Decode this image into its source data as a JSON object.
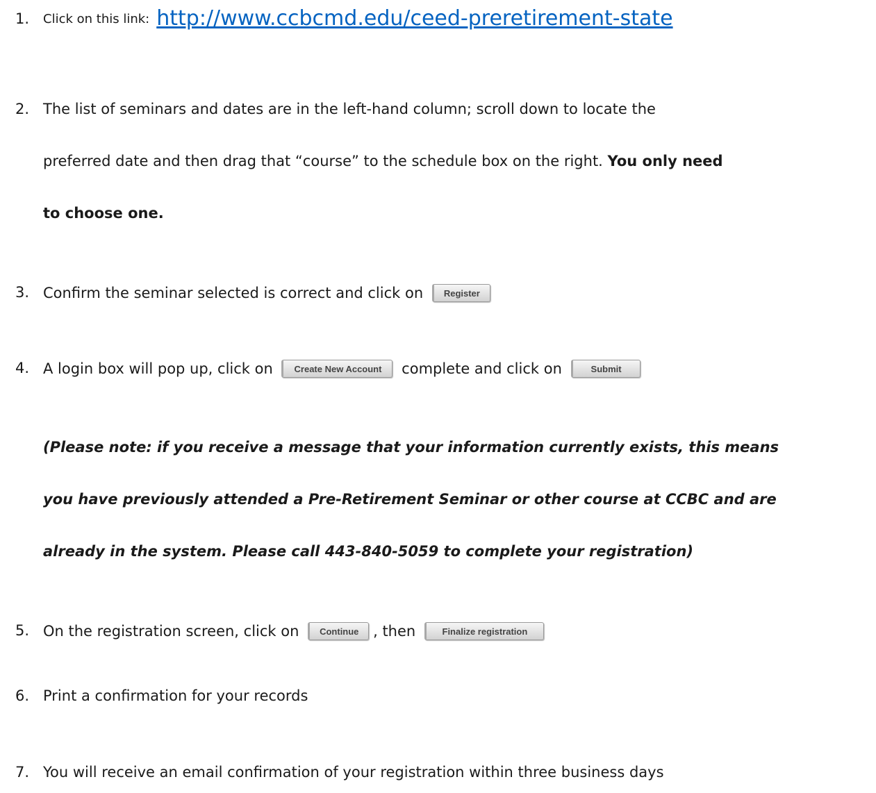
{
  "steps": [
    {
      "number": "1.",
      "text": "Click on this link:",
      "link": "http://www.ccbcmd.edu/ceed-preretirement-state"
    },
    {
      "number": "2.",
      "line1": "The list of seminars and dates are in the left-hand column; scroll down to locate the",
      "line2_plain": "preferred date and then drag that “course” to the schedule box on the right.",
      "line2_bold": "You only need",
      "line3_bold": "to choose one."
    },
    {
      "number": "3.",
      "text": "Confirm the seminar selected is correct and click on",
      "button": "Register"
    },
    {
      "number": "4.",
      "text_before": "A login box will pop up, click on",
      "button_create": "Create New Account",
      "text_middle": "complete and click on",
      "button_submit": "Submit",
      "note_lines": [
        "(Please note: if you receive a message that your information currently exists, this means",
        "you have previously attended a Pre-Retirement Seminar or other course at CCBC and are",
        "already in the system. Please call 443-840-5059 to complete your registration)"
      ]
    },
    {
      "number": "5.",
      "text_before": "On the registration screen, click on",
      "button_continue": "Continue",
      "text_middle": ", then",
      "button_finalize": "Finalize registration"
    },
    {
      "number": "6.",
      "text": "Print a confirmation for your records"
    },
    {
      "number": "7.",
      "text": "You will receive an email confirmation of your registration within three business days"
    }
  ]
}
